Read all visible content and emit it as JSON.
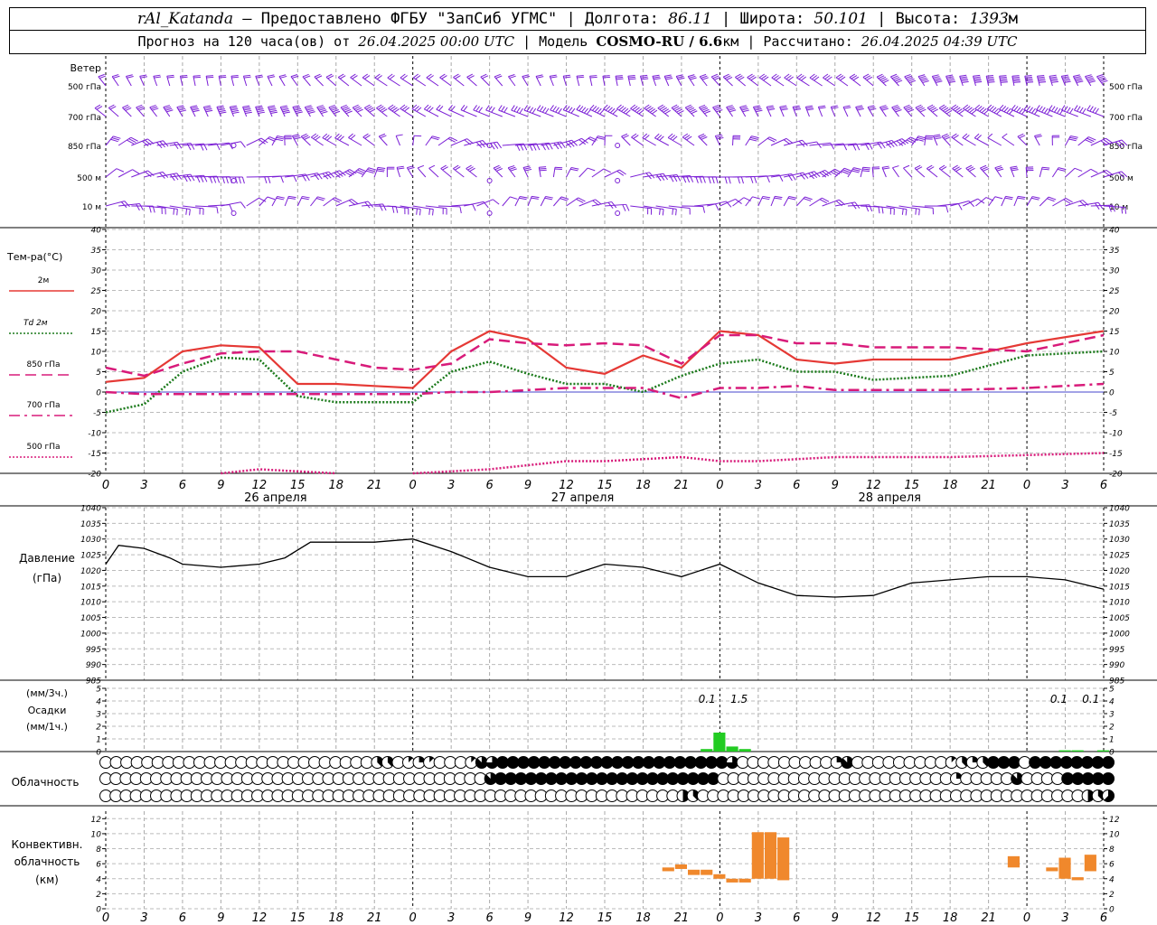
{
  "header": {
    "station": "rAl_Katanda",
    "dash": " — ",
    "provider": "Предоставлено ФГБУ \"ЗапСиб УГМС\"",
    "sep": " | ",
    "lon_label": "Долгота: ",
    "lon": "86.11",
    "lat_label": "Широта: ",
    "lat": "50.101",
    "alt_label": "Высота: ",
    "alt": "1393",
    "alt_unit": "м",
    "forecast_label": "Прогноз на 120 часа(ов) от ",
    "forecast_from": "26.04.2025 00:00 UTC",
    "model_label": " | Модель ",
    "model": "COSMO-RU / 6.6",
    "model_unit": "км",
    "calc_label": " | Рассчитано: ",
    "calc_time": "26.04.2025 04:39 UTC"
  },
  "chart_data": [
    {
      "type": "wind_barbs",
      "title": "Ветер",
      "levels": [
        "500 гПа",
        "700 гПа",
        "850 гПа",
        "500 м",
        "10 м"
      ],
      "color": "#7b1fd6"
    },
    {
      "type": "line",
      "ylabel": "Тем-ра(°C)",
      "ylim": [
        -20,
        40
      ],
      "yticks": [
        -20,
        -15,
        -10,
        -5,
        0,
        5,
        10,
        15,
        20,
        25,
        30,
        35,
        40
      ],
      "x_hours": [
        0,
        3,
        6,
        9,
        12,
        15,
        18,
        21,
        24,
        27,
        30,
        33,
        36,
        39,
        42,
        45,
        48,
        51,
        54,
        57,
        60,
        63,
        66,
        69,
        72,
        75,
        78
      ],
      "x_tick_labels": [
        "0",
        "3",
        "6",
        "9",
        "12",
        "15",
        "18",
        "21",
        "0",
        "3",
        "6",
        "9",
        "12",
        "15",
        "18",
        "21",
        "0",
        "3",
        "6",
        "9",
        "12",
        "15",
        "18",
        "21",
        "0",
        "3",
        "6"
      ],
      "day_labels": [
        "26 апреля",
        "27 апреля",
        "28 апреля"
      ],
      "series": [
        {
          "name": "2м",
          "color": "#e53935",
          "style": "solid",
          "values": [
            2.5,
            3.5,
            10,
            11.5,
            11,
            2,
            2,
            1.5,
            1,
            10,
            15,
            13,
            6,
            4.5,
            9,
            6,
            15,
            14,
            8,
            7,
            8,
            8,
            12,
            15
          ]
        },
        {
          "name": "Td 2м",
          "color": "#1b7a1b",
          "style": "dotted",
          "values": [
            -5,
            -3,
            5,
            8.5,
            8,
            -1,
            -2.5,
            -2.5,
            -2.5,
            5,
            7.5,
            4.5,
            2,
            2,
            0,
            4,
            7,
            8,
            5,
            5,
            3,
            4,
            9,
            10
          ]
        },
        {
          "name": "850 гПа",
          "color": "#d81b7a",
          "style": "dash",
          "values": [
            6,
            4,
            7,
            9.5,
            10,
            10,
            8,
            6,
            5.5,
            7,
            13,
            12,
            11.5,
            12,
            11.5,
            7,
            14,
            14,
            12,
            12,
            11,
            11,
            10,
            14
          ]
        },
        {
          "name": "700 гПа",
          "color": "#d81b7a",
          "style": "dashdot",
          "values": [
            0,
            -0.5,
            -0.5,
            -0.5,
            -0.5,
            -0.5,
            -0.5,
            -0.5,
            -0.5,
            0,
            0,
            0.5,
            1,
            1,
            1,
            -1.5,
            1,
            1,
            1.5,
            0.5,
            0.5,
            0.5,
            1,
            2
          ]
        },
        {
          "name": "500 гПа",
          "color": "#d81b7a",
          "style": "dotted",
          "values": [
            null,
            null,
            null,
            -20,
            -19,
            -19.5,
            -20,
            null,
            -20,
            -19.5,
            -19,
            -18,
            -17,
            -17,
            -16.5,
            -16,
            -17,
            -17,
            -16.5,
            -16,
            -16,
            -16,
            -15.5,
            -15
          ]
        }
      ],
      "series_hours": [
        0,
        3,
        6,
        9,
        12,
        15,
        18,
        21,
        24,
        27,
        30,
        33,
        36,
        39,
        42,
        45,
        48,
        51,
        54,
        57,
        60,
        66,
        72,
        78
      ]
    },
    {
      "type": "line",
      "ylabel": "Давление",
      "yunit": "(гПа)",
      "ylim": [
        985,
        1040
      ],
      "yticks": [
        985,
        990,
        995,
        1000,
        1005,
        1010,
        1015,
        1020,
        1025,
        1030,
        1035,
        1040
      ],
      "series": [
        {
          "name": "",
          "color": "#000000",
          "hours": [
            0,
            1,
            3,
            5,
            6,
            9,
            12,
            14,
            16,
            18,
            21,
            24,
            27,
            30,
            33,
            36,
            39,
            42,
            45,
            48,
            51,
            54,
            57,
            60,
            63,
            66,
            69,
            72,
            75,
            78
          ],
          "values": [
            1022,
            1028,
            1027,
            1024,
            1022,
            1021,
            1022,
            1024,
            1029,
            1029,
            1029,
            1030,
            1026,
            1021,
            1018,
            1018,
            1022,
            1021,
            1018,
            1022,
            1016,
            1012,
            1011.5,
            1012,
            1016,
            1017,
            1018,
            1018,
            1017,
            1014
          ]
        }
      ]
    },
    {
      "type": "bar",
      "ylabel": "Осадки",
      "yunit_top": "(мм/3ч.)",
      "yunit_bottom": "(мм/1ч.)",
      "ylim": [
        0,
        5
      ],
      "color": "#22cc22",
      "bars": [
        {
          "hour": 47,
          "value": 0.2
        },
        {
          "hour": 48,
          "value": 1.5
        },
        {
          "hour": 49,
          "value": 0.4
        },
        {
          "hour": 50,
          "value": 0.2
        },
        {
          "hour": 75,
          "value": 0.1
        },
        {
          "hour": 76,
          "value": 0.1
        },
        {
          "hour": 78,
          "value": 0.1
        }
      ],
      "annotations": [
        {
          "hour": 47,
          "text": "0.1"
        },
        {
          "hour": 49.5,
          "text": "1.5"
        },
        {
          "hour": 74.5,
          "text": "0.1"
        },
        {
          "hour": 77,
          "text": "0.1"
        }
      ]
    },
    {
      "type": "cloud_symbols",
      "label": "Облачность",
      "rows": [
        {
          "name": "high",
          "cover": "0000000000000000000000000033012100017688888888888888888888886000000000270000000001323888088888888"
        },
        {
          "name": "mid",
          "cover": "0000000000000000000000000000000000000078888888888888888888888000000000000000000000002000007000088888"
        },
        {
          "name": "low",
          "cover": "0000000000000000000000000000000000000000000000000000000004300000000000000000000000000000000000000435"
        }
      ]
    },
    {
      "type": "bar_range",
      "ylabel": "Конвективн. облачность (км)",
      "ylim": [
        0,
        13
      ],
      "yticks": [
        0,
        2,
        4,
        6,
        8,
        10,
        12
      ],
      "color": "#f0882c",
      "bars": [
        {
          "hour": 44,
          "bottom": 5.0,
          "top": 5.5
        },
        {
          "hour": 45,
          "bottom": 5.3,
          "top": 5.9
        },
        {
          "hour": 46,
          "bottom": 4.5,
          "top": 5.2
        },
        {
          "hour": 47,
          "bottom": 4.5,
          "top": 5.2
        },
        {
          "hour": 48,
          "bottom": 4.0,
          "top": 4.6
        },
        {
          "hour": 49,
          "bottom": 3.5,
          "top": 4.0
        },
        {
          "hour": 50,
          "bottom": 3.5,
          "top": 4.0
        },
        {
          "hour": 51,
          "bottom": 4.0,
          "top": 10.2
        },
        {
          "hour": 52,
          "bottom": 4.0,
          "top": 10.2
        },
        {
          "hour": 53,
          "bottom": 3.8,
          "top": 9.5
        },
        {
          "hour": 71,
          "bottom": 5.5,
          "top": 7.0
        },
        {
          "hour": 74,
          "bottom": 5.0,
          "top": 5.5
        },
        {
          "hour": 75,
          "bottom": 4.0,
          "top": 6.8
        },
        {
          "hour": 76,
          "bottom": 3.8,
          "top": 4.2
        },
        {
          "hour": 77,
          "bottom": 5.0,
          "top": 7.2
        }
      ]
    }
  ]
}
